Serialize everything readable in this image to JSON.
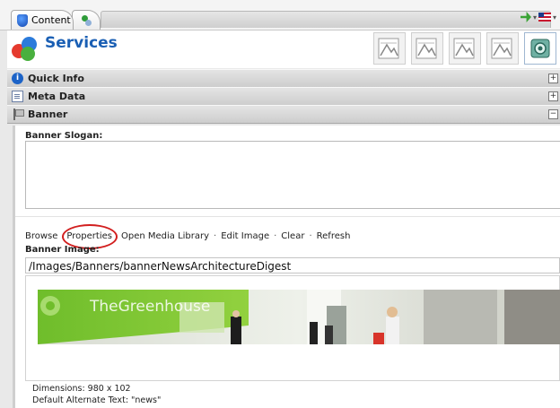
{
  "tabs": [
    {
      "label": "Content",
      "icon": "shield-icon"
    },
    {
      "label": "",
      "icon": "hierarchy-icon"
    }
  ],
  "header": {
    "title": "Services"
  },
  "sections": [
    {
      "label": "Quick Info",
      "icon": "info-icon",
      "toggle": "+"
    },
    {
      "label": "Meta Data",
      "icon": "document-icon",
      "toggle": "+"
    },
    {
      "label": "Banner",
      "icon": "banner-icon",
      "toggle": "−"
    }
  ],
  "banner": {
    "slogan_label": "Banner Slogan:",
    "slogan_value": "",
    "links": {
      "browse": "Browse",
      "properties": "Properties",
      "open_media_library": "Open Media Library",
      "edit_image": "Edit Image",
      "clear": "Clear",
      "refresh": "Refresh",
      "separator": "·"
    },
    "image_label": "Banner Image:",
    "image_path": "/Images/Banners/bannerNewsArchitectureDigest",
    "preview_text": "TheGreenhouse",
    "dimensions": "Dimensions: 980 x 102",
    "alt_text": "Default Alternate Text: \"news\""
  },
  "colors": {
    "accent": "#1a5fb4",
    "highlight": "#d21f1f",
    "greenhouse": "#7ec832"
  }
}
